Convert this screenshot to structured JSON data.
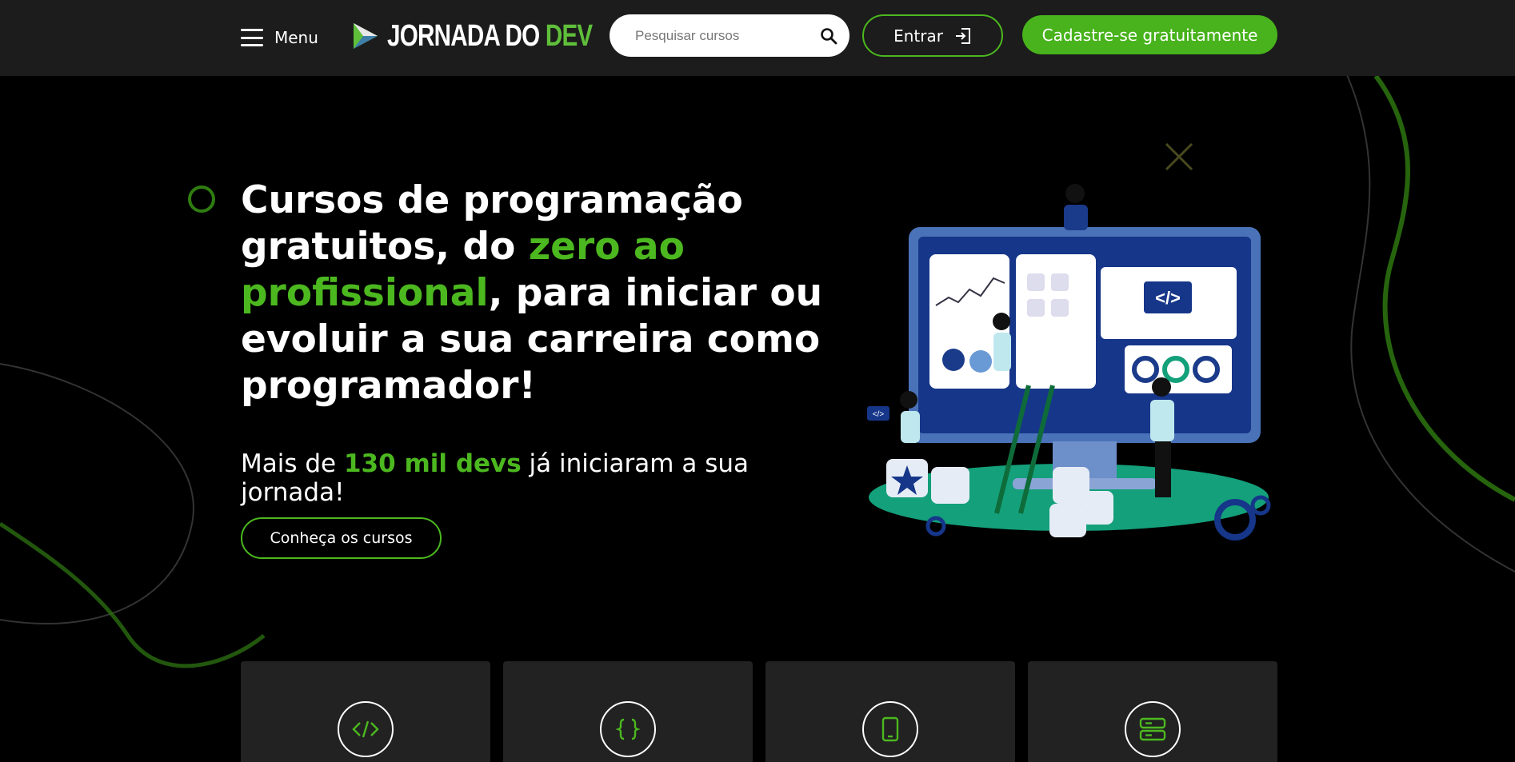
{
  "header": {
    "menu_label": "Menu",
    "logo": {
      "word1": "JORNADA DO ",
      "word2": "DEV"
    },
    "search_placeholder": "Pesquisar cursos",
    "login_label": "Entrar",
    "signup_label": "Cadastre-se gratuitamente"
  },
  "hero": {
    "title_part1": "Cursos de programação gratuitos, do ",
    "title_highlight": "zero ao profissional",
    "title_part2": ", para iniciar ou evoluir a sua carreira como programador!",
    "subtitle_prefix": "Mais de ",
    "subtitle_highlight": "130 mil devs",
    "subtitle_suffix": " já iniciaram a sua jornada!",
    "cta_label": "Conheça os cursos",
    "illustration_code_label": "</>",
    "illustration_small_code_label": "</>"
  },
  "feature_cards": [
    {
      "icon": "code-icon"
    },
    {
      "icon": "braces-icon"
    },
    {
      "icon": "mobile-icon"
    },
    {
      "icon": "server-icon"
    }
  ],
  "colors": {
    "accent": "#4cb81f",
    "header_bg": "#1c1c1c",
    "page_bg": "#000000",
    "card_bg": "#222222"
  }
}
